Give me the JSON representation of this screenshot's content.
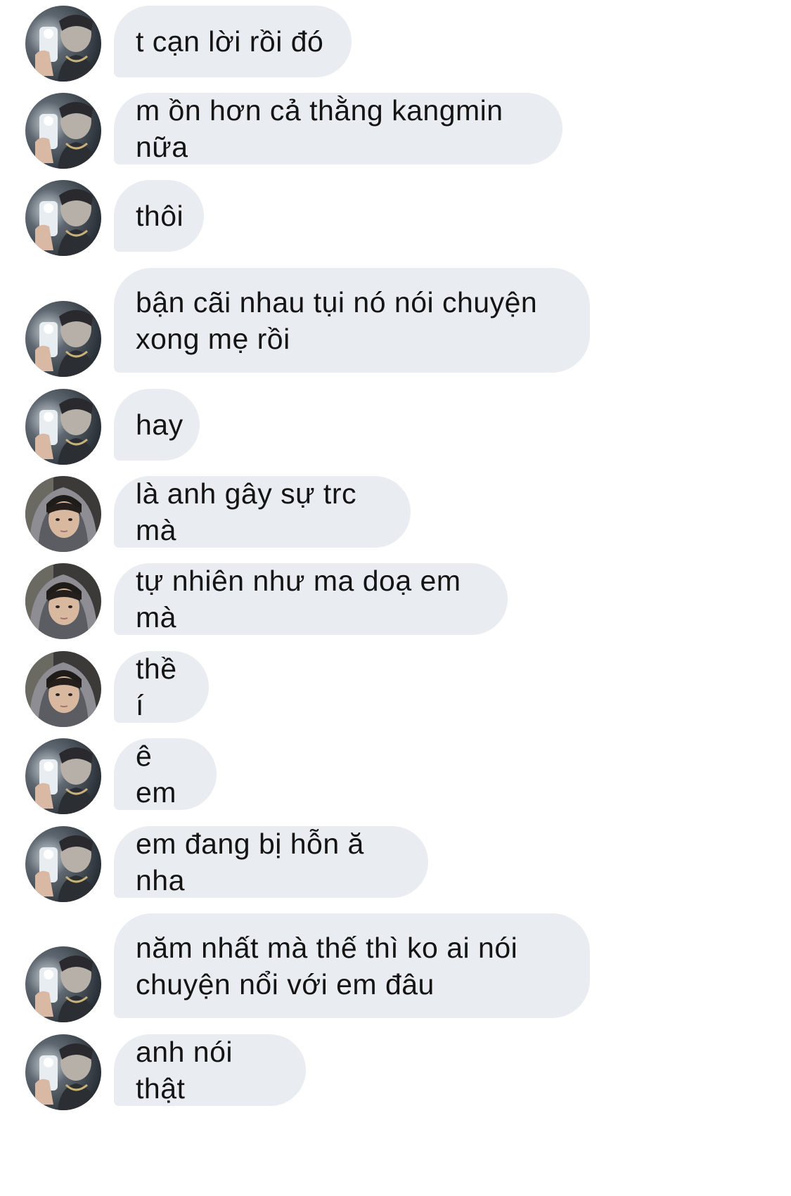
{
  "conversation": {
    "messages": [
      {
        "sender": "a",
        "text": "t cạn lời rồi đó"
      },
      {
        "sender": "a",
        "text": "m ồn hơn cả thằng kangmin nữa"
      },
      {
        "sender": "a",
        "text": "thôi"
      },
      {
        "sender": "a",
        "text": "bận cãi nhau tụi nó nói chuyện\nxong mẹ rồi"
      },
      {
        "sender": "a",
        "text": "hay"
      },
      {
        "sender": "b",
        "text": "là anh gây sự trc mà"
      },
      {
        "sender": "b",
        "text": "tự nhiên như ma doạ em mà"
      },
      {
        "sender": "b",
        "text": "thề í"
      },
      {
        "sender": "a",
        "text": "ê em"
      },
      {
        "sender": "a",
        "text": "em đang bị hỗn ă nha"
      },
      {
        "sender": "a",
        "text": "năm nhất mà thế thì ko ai nói\nchuyện nổi với em đâu"
      },
      {
        "sender": "a",
        "text": "anh nói thật"
      }
    ]
  },
  "theme": {
    "bubble_color": "#e9ecf1",
    "text_color": "#141414",
    "background": "#ffffff"
  },
  "icons": {
    "avatar_a": "avatar-mirror-selfie-icon",
    "avatar_b": "avatar-hooded-portrait-icon"
  }
}
